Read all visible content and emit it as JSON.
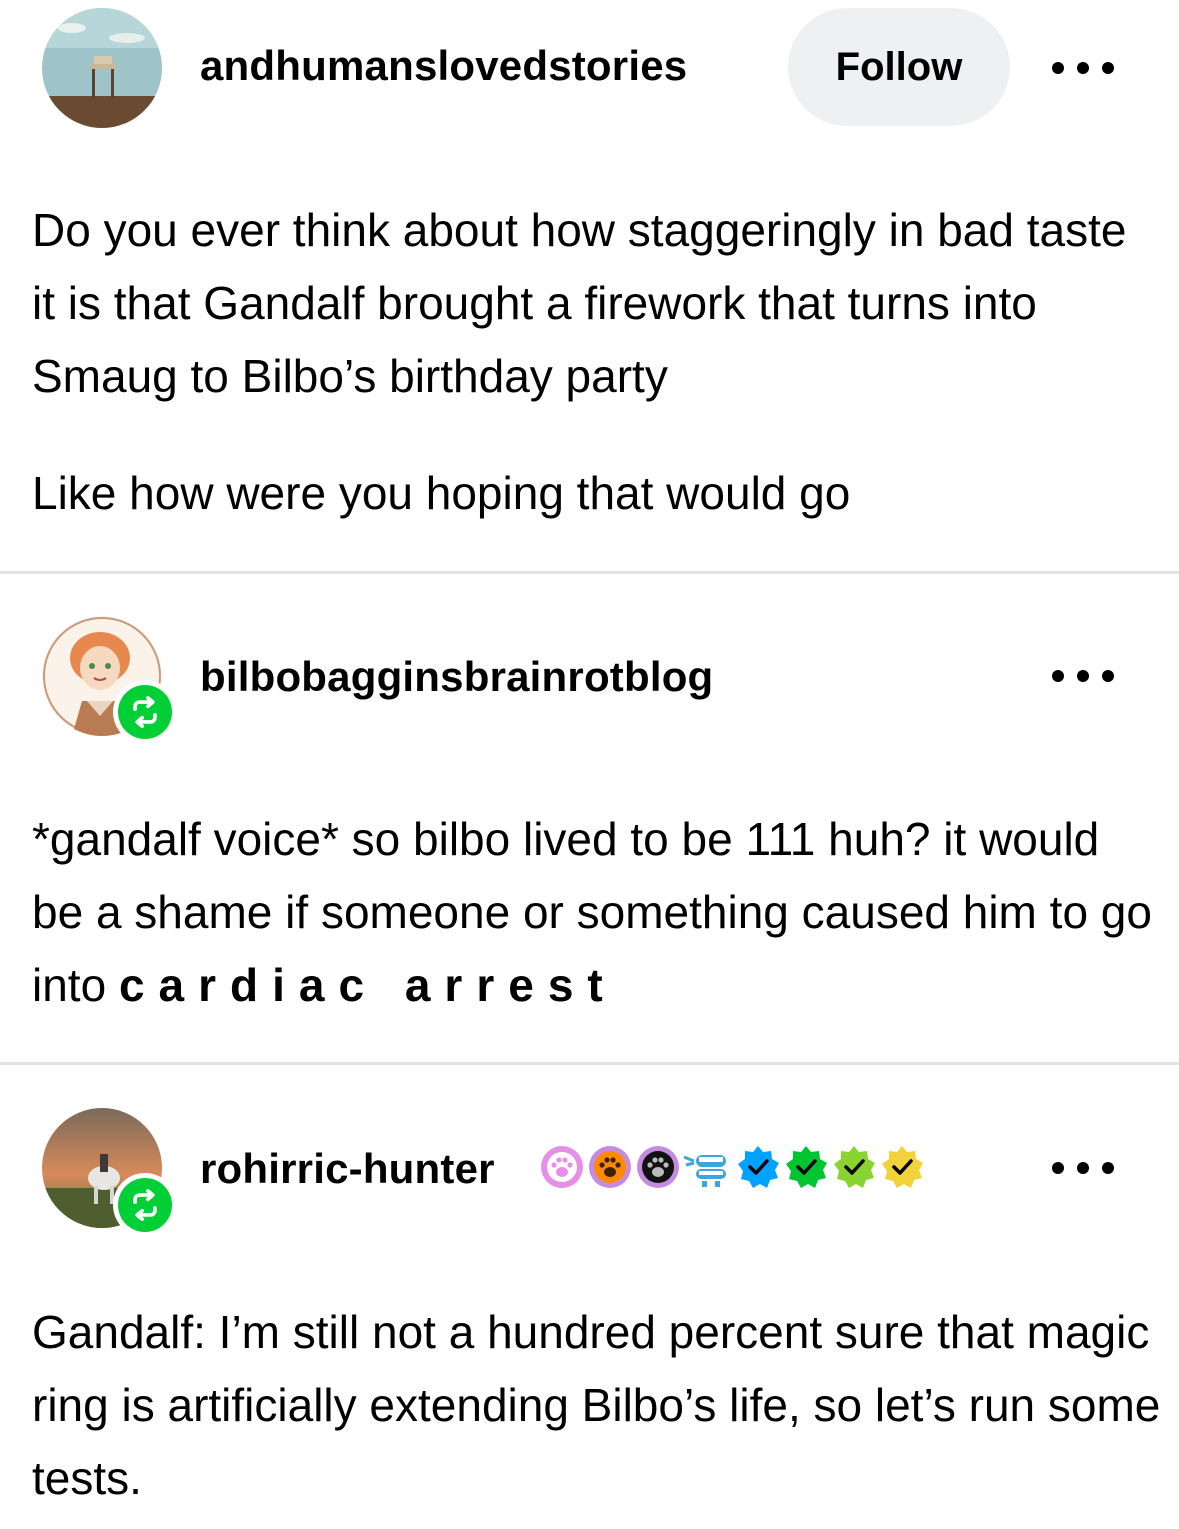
{
  "posts": [
    {
      "username": "andhumanslovedstories",
      "follow_label": "Follow",
      "paragraphs": [
        "Do you ever think about how staggeringly in bad taste it is that Gandalf brought a firework that turns into Smaug to Bilbo’s birthday party",
        "Like how were you hoping that would go"
      ]
    },
    {
      "username": "bilbobagginsbrainrotblog",
      "text_before": "*gandalf voice* so bilbo lived to be 111 huh? it would be a shame if someone or something caused him to go into ",
      "text_spaced": "cardiac arrest"
    },
    {
      "username": "rohirric-hunter",
      "badges": [
        "paw-pink-icon",
        "paw-orange-icon",
        "paw-black-icon",
        "wind-up-teeth-icon",
        "check-blue-icon",
        "check-green-icon",
        "check-lime-icon",
        "check-yellow-icon"
      ],
      "text": "Gandalf: I’m still not a hundred percent sure that magic ring is artificially extending Bilbo’s life, so let’s run some tests."
    }
  ],
  "colors": {
    "reblog_green": "#00cf35",
    "follow_bg": "#eef0f2",
    "divider": "#e3e3e3"
  }
}
